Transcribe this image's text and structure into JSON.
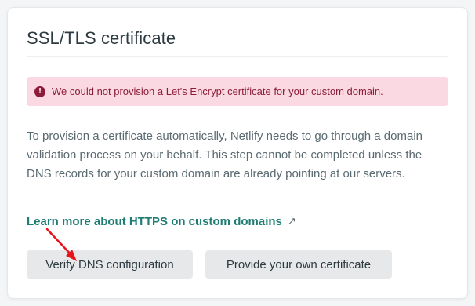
{
  "card": {
    "title": "SSL/TLS certificate"
  },
  "alert": {
    "icon": "exclamation-circle-icon",
    "icon_glyph": "!",
    "message": "We could not provision a Let's Encrypt certificate for your custom domain.",
    "background_color": "#fbd9e2",
    "text_color": "#8c1d3a"
  },
  "description": "To provision a certificate automatically, Netlify needs to go through a domain validation process on your behalf. This step cannot be completed unless the DNS records for your custom domain are already pointing at our servers.",
  "learn_more": {
    "label": "Learn more about HTTPS on custom domains",
    "icon": "external-link-icon",
    "icon_glyph": "↗",
    "color": "#1f7d74"
  },
  "buttons": {
    "verify_dns": "Verify DNS configuration",
    "provide_certificate": "Provide your own certificate"
  },
  "annotation": {
    "icon": "red-pointer-arrow-icon",
    "color": "#e8141b"
  }
}
